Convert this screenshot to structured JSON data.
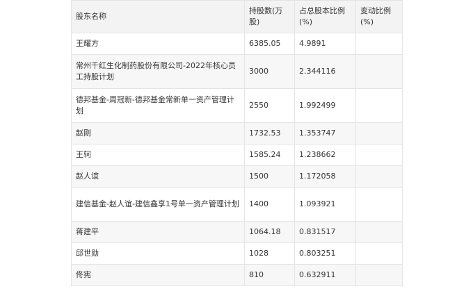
{
  "table": {
    "headers": [
      "股东名称",
      "持股数(万股)",
      "占总股本比例(%)",
      "变动比例(%)"
    ],
    "rows": [
      {
        "name": "王耀方",
        "shares": "6385.05",
        "ratio": "4.9891",
        "change": ""
      },
      {
        "name": "常州千红生化制药股份有限公司-2022年核心员工持股计划",
        "shares": "3000",
        "ratio": "2.344116",
        "change": ""
      },
      {
        "name": "德邦基金-周冠新-德邦基金常新单一资产管理计划",
        "shares": "2550",
        "ratio": "1.992499",
        "change": ""
      },
      {
        "name": "赵刚",
        "shares": "1732.53",
        "ratio": "1.353747",
        "change": ""
      },
      {
        "name": "王轲",
        "shares": "1585.24",
        "ratio": "1.238662",
        "change": ""
      },
      {
        "name": "赵人谊",
        "shares": "1500",
        "ratio": "1.172058",
        "change": ""
      },
      {
        "name": "建信基金-赵人谊-建信鑫享1号单一资产管理计划",
        "shares": "1400",
        "ratio": "1.093921",
        "change": ""
      },
      {
        "name": "蒋建平",
        "shares": "1064.18",
        "ratio": "0.831517",
        "change": ""
      },
      {
        "name": "邱世勋",
        "shares": "1028",
        "ratio": "0.803251",
        "change": ""
      },
      {
        "name": "佟宪",
        "shares": "810",
        "ratio": "0.632911",
        "change": ""
      }
    ]
  }
}
